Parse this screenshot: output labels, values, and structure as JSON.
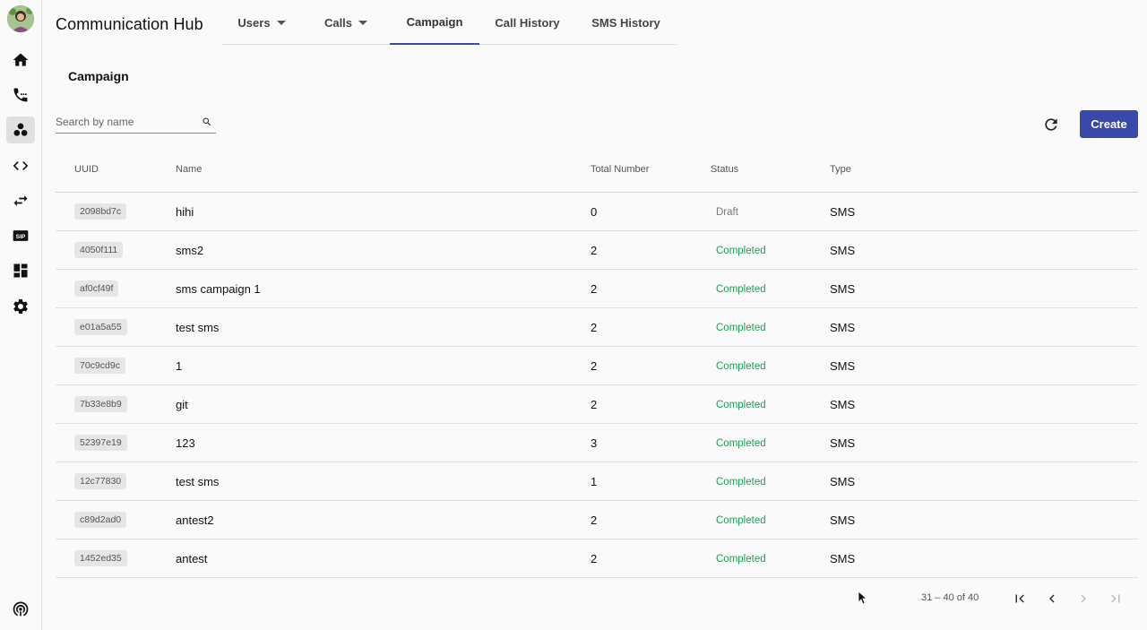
{
  "app": {
    "title": "Communication Hub"
  },
  "tabs": [
    {
      "label": "Users",
      "dropdown": true
    },
    {
      "label": "Calls",
      "dropdown": true
    },
    {
      "label": "Campaign",
      "active": true
    },
    {
      "label": "Call History"
    },
    {
      "label": "SMS History"
    }
  ],
  "page": {
    "heading": "Campaign"
  },
  "search": {
    "placeholder": "Search by name",
    "value": ""
  },
  "toolbar": {
    "create_label": "Create"
  },
  "sidebar": {
    "items": [
      "home-icon",
      "phone-forward-icon",
      "campaign-icon",
      "code-icon",
      "swap-icon",
      "sip-icon",
      "dashboard-icon",
      "settings-icon",
      "podcast-icon"
    ],
    "sip_text": "SIP"
  },
  "table": {
    "headers": {
      "uuid": "UUID",
      "name": "Name",
      "total": "Total Number",
      "status": "Status",
      "type": "Type"
    },
    "rows": [
      {
        "uuid": "2098bd7c",
        "name": "hihi",
        "total": "0",
        "status": "Draft",
        "type": "SMS"
      },
      {
        "uuid": "4050f111",
        "name": "sms2",
        "total": "2",
        "status": "Completed",
        "type": "SMS"
      },
      {
        "uuid": "af0cf49f",
        "name": "sms campaign 1",
        "total": "2",
        "status": "Completed",
        "type": "SMS"
      },
      {
        "uuid": "e01a5a55",
        "name": "test sms",
        "total": "2",
        "status": "Completed",
        "type": "SMS"
      },
      {
        "uuid": "70c9cd9c",
        "name": "1",
        "total": "2",
        "status": "Completed",
        "type": "SMS"
      },
      {
        "uuid": "7b33e8b9",
        "name": "git",
        "total": "2",
        "status": "Completed",
        "type": "SMS"
      },
      {
        "uuid": "52397e19",
        "name": "123",
        "total": "3",
        "status": "Completed",
        "type": "SMS"
      },
      {
        "uuid": "12c77830",
        "name": "test sms",
        "total": "1",
        "status": "Completed",
        "type": "SMS"
      },
      {
        "uuid": "c89d2ad0",
        "name": "antest2",
        "total": "2",
        "status": "Completed",
        "type": "SMS"
      },
      {
        "uuid": "1452ed35",
        "name": "antest",
        "total": "2",
        "status": "Completed",
        "type": "SMS"
      }
    ]
  },
  "pagination": {
    "range_label": "31 – 40 of 40"
  },
  "colors": {
    "accent": "#3949ab",
    "completed": "#1e9e55",
    "draft": "#777777"
  }
}
